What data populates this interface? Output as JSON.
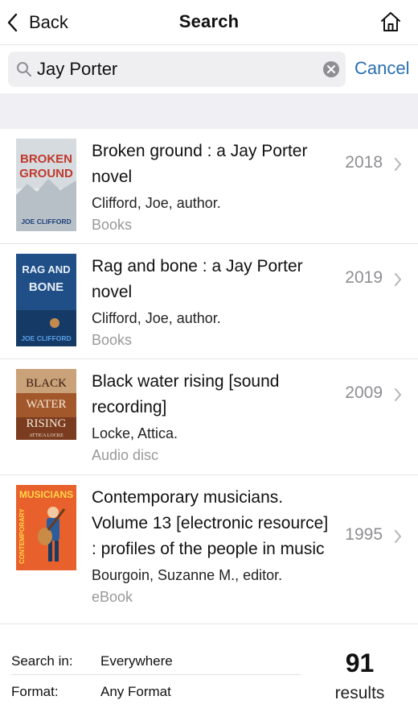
{
  "nav": {
    "back_label": "Back",
    "title": "Search",
    "home_icon": "home-icon"
  },
  "search": {
    "query": "Jay Porter",
    "placeholder": "",
    "cancel_label": "Cancel"
  },
  "results": [
    {
      "title": "Broken ground : a Jay Porter novel",
      "author": "Clifford, Joe, author.",
      "format": "Books",
      "year": "2018",
      "cover": {
        "lines": [
          "BROKEN",
          "GROUND"
        ],
        "author": "JOE CLIFFORD",
        "colors": {
          "bg": "#d6dbe0",
          "title": "#c0392b",
          "author": "#1d3f7a"
        }
      }
    },
    {
      "title": "Rag and bone : a Jay Porter novel",
      "author": "Clifford, Joe, author.",
      "format": "Books",
      "year": "2019",
      "cover": {
        "lines": [
          "RAG AND",
          "BONE"
        ],
        "author": "JOE CLIFFORD",
        "colors": {
          "bg": "#1f4f86",
          "title": "#e6eef8",
          "author": "#5aa0e6"
        }
      }
    },
    {
      "title": "Black water rising [sound recording]",
      "author": "Locke, Attica.",
      "format": "Audio disc",
      "year": "2009",
      "cover": {
        "lines": [
          "BLACK",
          "WATER",
          "RISING"
        ],
        "author": "ATTICA LOCKE",
        "colors": {
          "bg": "#7a3b1e",
          "title": "#f4e9d8",
          "author": "#f4e9d8"
        }
      }
    },
    {
      "title": "Contemporary musicians. Volume 13 [electronic resource] : profiles of the people in music",
      "author": "Bourgoin, Suzanne M., editor.",
      "format": "eBook",
      "year": "1995",
      "cover": {
        "lines": [
          "MUSICIANS"
        ],
        "author": "CONTEMPORARY",
        "colors": {
          "bg": "#e8612c",
          "title": "#ffd54a",
          "author": "#ffd54a"
        }
      }
    }
  ],
  "footer": {
    "search_in_label": "Search in:",
    "search_in_value": "Everywhere",
    "format_label": "Format:",
    "format_value": "Any Format",
    "count": "91",
    "count_label": "results"
  },
  "colors": {
    "accent": "#2a6fb0",
    "secondary_text": "#8e8e93",
    "band": "#efeff4"
  }
}
